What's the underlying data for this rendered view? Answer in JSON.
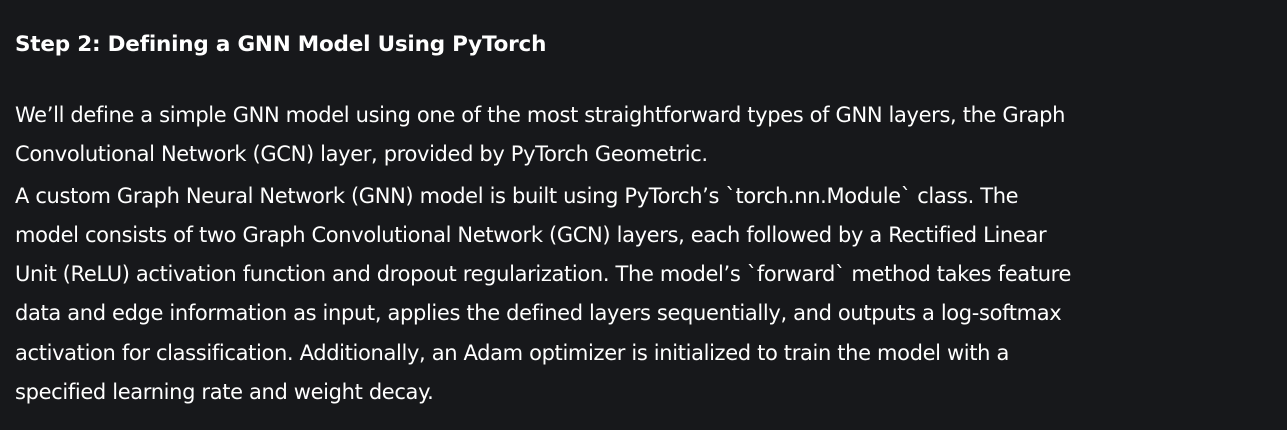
{
  "article": {
    "heading": "Step 2: Defining a GNN Model Using PyTorch",
    "paragraphs": [
      "We’ll define a simple GNN model using one of the most straightforward types of GNN layers, the Graph Convolutional Network (GCN) layer, provided by PyTorch Geometric.",
      "A custom Graph Neural Network (GNN) model is built using PyTorch’s `torch.nn.Module` class. The model consists of two Graph Convolutional Network (GCN) layers, each followed by a Rectified Linear Unit (ReLU) activation function and dropout regularization. The model’s `forward` method takes feature data and edge information as input, applies the defined layers sequentially, and outputs a log-softmax activation for classification. Additionally, an Adam optimizer is initialized to train the model with a specified learning rate and weight decay."
    ]
  },
  "colors": {
    "background": "#17181b",
    "text": "#ffffff"
  }
}
